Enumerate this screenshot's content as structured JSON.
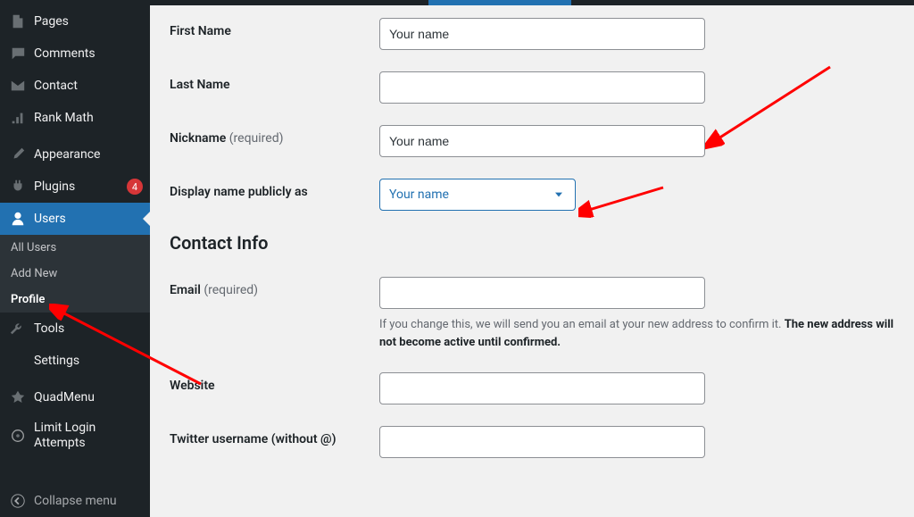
{
  "sidebar": {
    "items": [
      {
        "label": "Pages"
      },
      {
        "label": "Comments"
      },
      {
        "label": "Contact"
      },
      {
        "label": "Rank Math"
      },
      {
        "label": "Appearance"
      },
      {
        "label": "Plugins",
        "badge": "4"
      },
      {
        "label": "Users",
        "active": true
      },
      {
        "label": "Tools"
      },
      {
        "label": "Settings"
      },
      {
        "label": "QuadMenu"
      },
      {
        "label": "Limit Login Attempts"
      }
    ],
    "submenu": [
      {
        "label": "All Users"
      },
      {
        "label": "Add New"
      },
      {
        "label": "Profile",
        "current": true
      }
    ],
    "collapse": "Collapse menu"
  },
  "form": {
    "first_name": {
      "label": "First Name",
      "value": "Your name"
    },
    "last_name": {
      "label": "Last Name"
    },
    "nickname": {
      "label": "Nickname",
      "req": "(required)",
      "value": "Your name"
    },
    "display_name": {
      "label": "Display name publicly as",
      "value": "Your name"
    },
    "contact_heading": "Contact Info",
    "email": {
      "label": "Email",
      "req": "(required)",
      "desc_a": "If you change this, we will send you an email at your new address to confirm it. ",
      "desc_b": "The new address will not become active until confirmed."
    },
    "website": {
      "label": "Website"
    },
    "twitter": {
      "label": "Twitter username (without @)"
    }
  }
}
